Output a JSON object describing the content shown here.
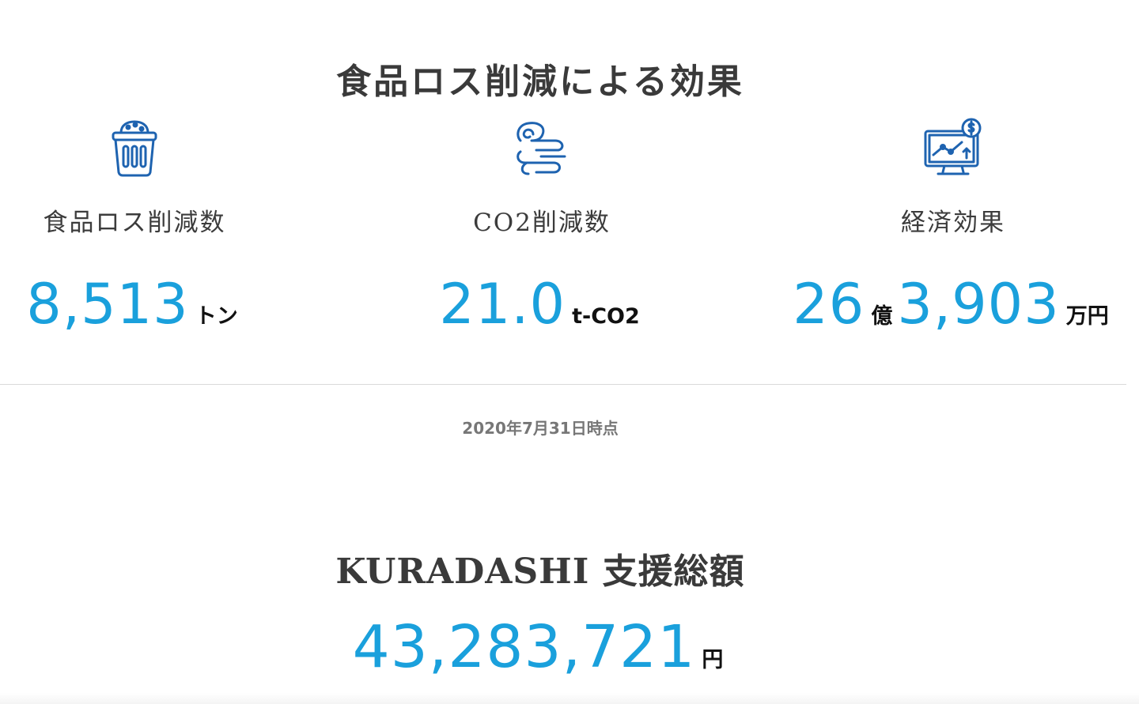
{
  "effect_section": {
    "title": "食品ロス削減による効果",
    "stats": [
      {
        "icon": "trash-bin-icon",
        "label": "食品ロス削減数",
        "value": "8,513",
        "unit": "トン"
      },
      {
        "icon": "wind-icon",
        "label": "CO2削減数",
        "value": "21.0",
        "unit": "t-CO2"
      },
      {
        "icon": "economic-chart-icon",
        "label": "経済効果",
        "value_oku": "26",
        "unit_oku": "億",
        "value_man": "3,903",
        "unit_man": "万円"
      }
    ],
    "as_of": "2020年7月31日時点"
  },
  "support_section": {
    "title": "KURADASHI 支援総額",
    "value": "43,283,721",
    "unit": "円"
  },
  "colors": {
    "accent": "#1aa0dc",
    "icon": "#1e63b0",
    "title_text": "#3a3a3a",
    "divider": "#d9d9d9"
  }
}
